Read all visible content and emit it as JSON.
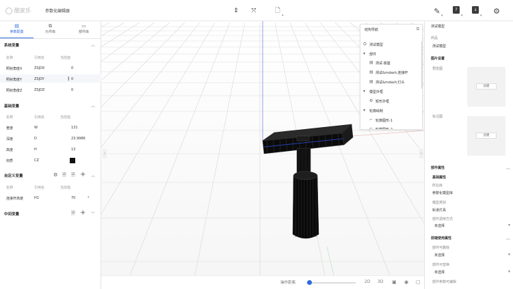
{
  "topbar": {
    "logo_text": "酷家乐",
    "title": "参数化编辑器"
  },
  "left_tabs": [
    {
      "label": "参数配置",
      "icon": "document-icon",
      "active": true
    },
    {
      "label": "元件库",
      "icon": "link-icon",
      "active": false
    },
    {
      "label": "部件库",
      "icon": "folder-icon",
      "active": false
    }
  ],
  "system_vars": {
    "title": "系统变量",
    "columns": [
      "名称",
      "引用名",
      "当前值"
    ],
    "rows": [
      {
        "name": "照射角度X",
        "ref": "ZSJDX",
        "value": "0"
      },
      {
        "name": "照射角度Y",
        "ref": "ZSJDY",
        "value": "0"
      },
      {
        "name": "照射角度Z",
        "ref": "ZSJDZ",
        "value": "0"
      }
    ]
  },
  "basic_vars": {
    "title": "基础变量",
    "columns": [
      "名称",
      "引用名",
      "当前值"
    ],
    "rows": [
      {
        "name": "宽度",
        "ref": "W",
        "value": "131"
      },
      {
        "name": "深度",
        "ref": "D",
        "value": "23.9986"
      },
      {
        "name": "高度",
        "ref": "H",
        "value": "13"
      },
      {
        "name": "材质",
        "ref": "CZ",
        "value": ""
      }
    ],
    "material_color": "#111111"
  },
  "custom_vars": {
    "title": "自定义变量",
    "columns": [
      "名称",
      "引用名",
      "当前值"
    ],
    "rows": [
      {
        "name": "连接杆高度",
        "ref": "H1",
        "value": "70"
      }
    ]
  },
  "middle_vars": {
    "title": "中间变量"
  },
  "nav": {
    "title": "结构导航",
    "items": [
      {
        "label": "测试模型",
        "icon": "cube-icon",
        "level": 0
      },
      {
        "label": "部件",
        "icon": "caret-down-icon",
        "level": 0
      },
      {
        "label": "测试-底座",
        "icon": "component-icon",
        "level": 1
      },
      {
        "label": "测试&mdash;连接杆",
        "icon": "component-icon",
        "level": 1
      },
      {
        "label": "测试&mdash;灯头",
        "icon": "component-icon",
        "level": 1
      },
      {
        "label": "模型外框",
        "icon": "caret-down-icon",
        "level": 0
      },
      {
        "label": "矩形外框",
        "icon": "gear-icon",
        "level": 1
      },
      {
        "label": "轮廓绘制",
        "icon": "caret-down-icon",
        "level": 0
      },
      {
        "label": "轮廓图形-1",
        "icon": "shape-icon",
        "level": 1
      },
      {
        "label": "轮廓图形-2",
        "icon": "shape-icon",
        "level": 1
      }
    ]
  },
  "right_panel": {
    "model_label": "测试模型",
    "product_label": "商品",
    "product_value": "测试模型",
    "image_settings": "图片设置",
    "preview_label": "预览图",
    "annotation_label": "标注图",
    "create_label": "创建",
    "part_props": "部件属性",
    "basic_props": "基础属性",
    "owner_label": "所在库",
    "owner_value": "参数化模型库",
    "model_category_label": "模型类别",
    "model_category_value": "轨道灯具",
    "call_mode_label": "部件调用方式",
    "call_mode_value": "未选择",
    "frontend_props": "前端使用属性",
    "deletable_label": "部件可删除",
    "deletable_value": "未选择",
    "replaceable_label": "部件可替换",
    "replaceable_value": "未选择",
    "editable_label": "部件参数可编辑"
  },
  "bottombar": {
    "zoom_label": "操作距离",
    "zoom_level": 0.05,
    "mode_2d": "2D",
    "mode_3d": "3D"
  },
  "colors": {
    "accent": "#2d6ae0",
    "border": "#e3e3e3"
  }
}
